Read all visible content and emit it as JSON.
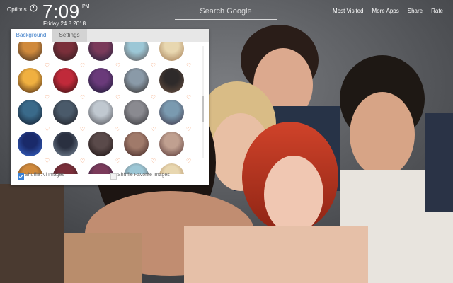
{
  "topbar": {
    "options_label": "Options",
    "time": "7:09",
    "ampm": "PM",
    "date": "Friday  24.8.2018",
    "search_placeholder": "Search Google",
    "links": [
      "Most Visited",
      "More Apps",
      "Share",
      "Rate"
    ]
  },
  "panel": {
    "tabs": [
      "Background",
      "Settings"
    ],
    "active_tab": "Background",
    "thumbnail_rows": 5,
    "thumbnail_columns": 5,
    "shuffle_all_label": "Shuffle All Images",
    "shuffle_all_checked": true,
    "shuffle_fav_label": "Shuffle Favorite Images",
    "shuffle_fav_checked": false
  },
  "colors": {
    "accent": "#3b82d6",
    "heart": "#f08b53",
    "tab_active_text": "#3f7fc9"
  },
  "icons": [
    "clock-icon",
    "heart-icon",
    "check-icon"
  ]
}
